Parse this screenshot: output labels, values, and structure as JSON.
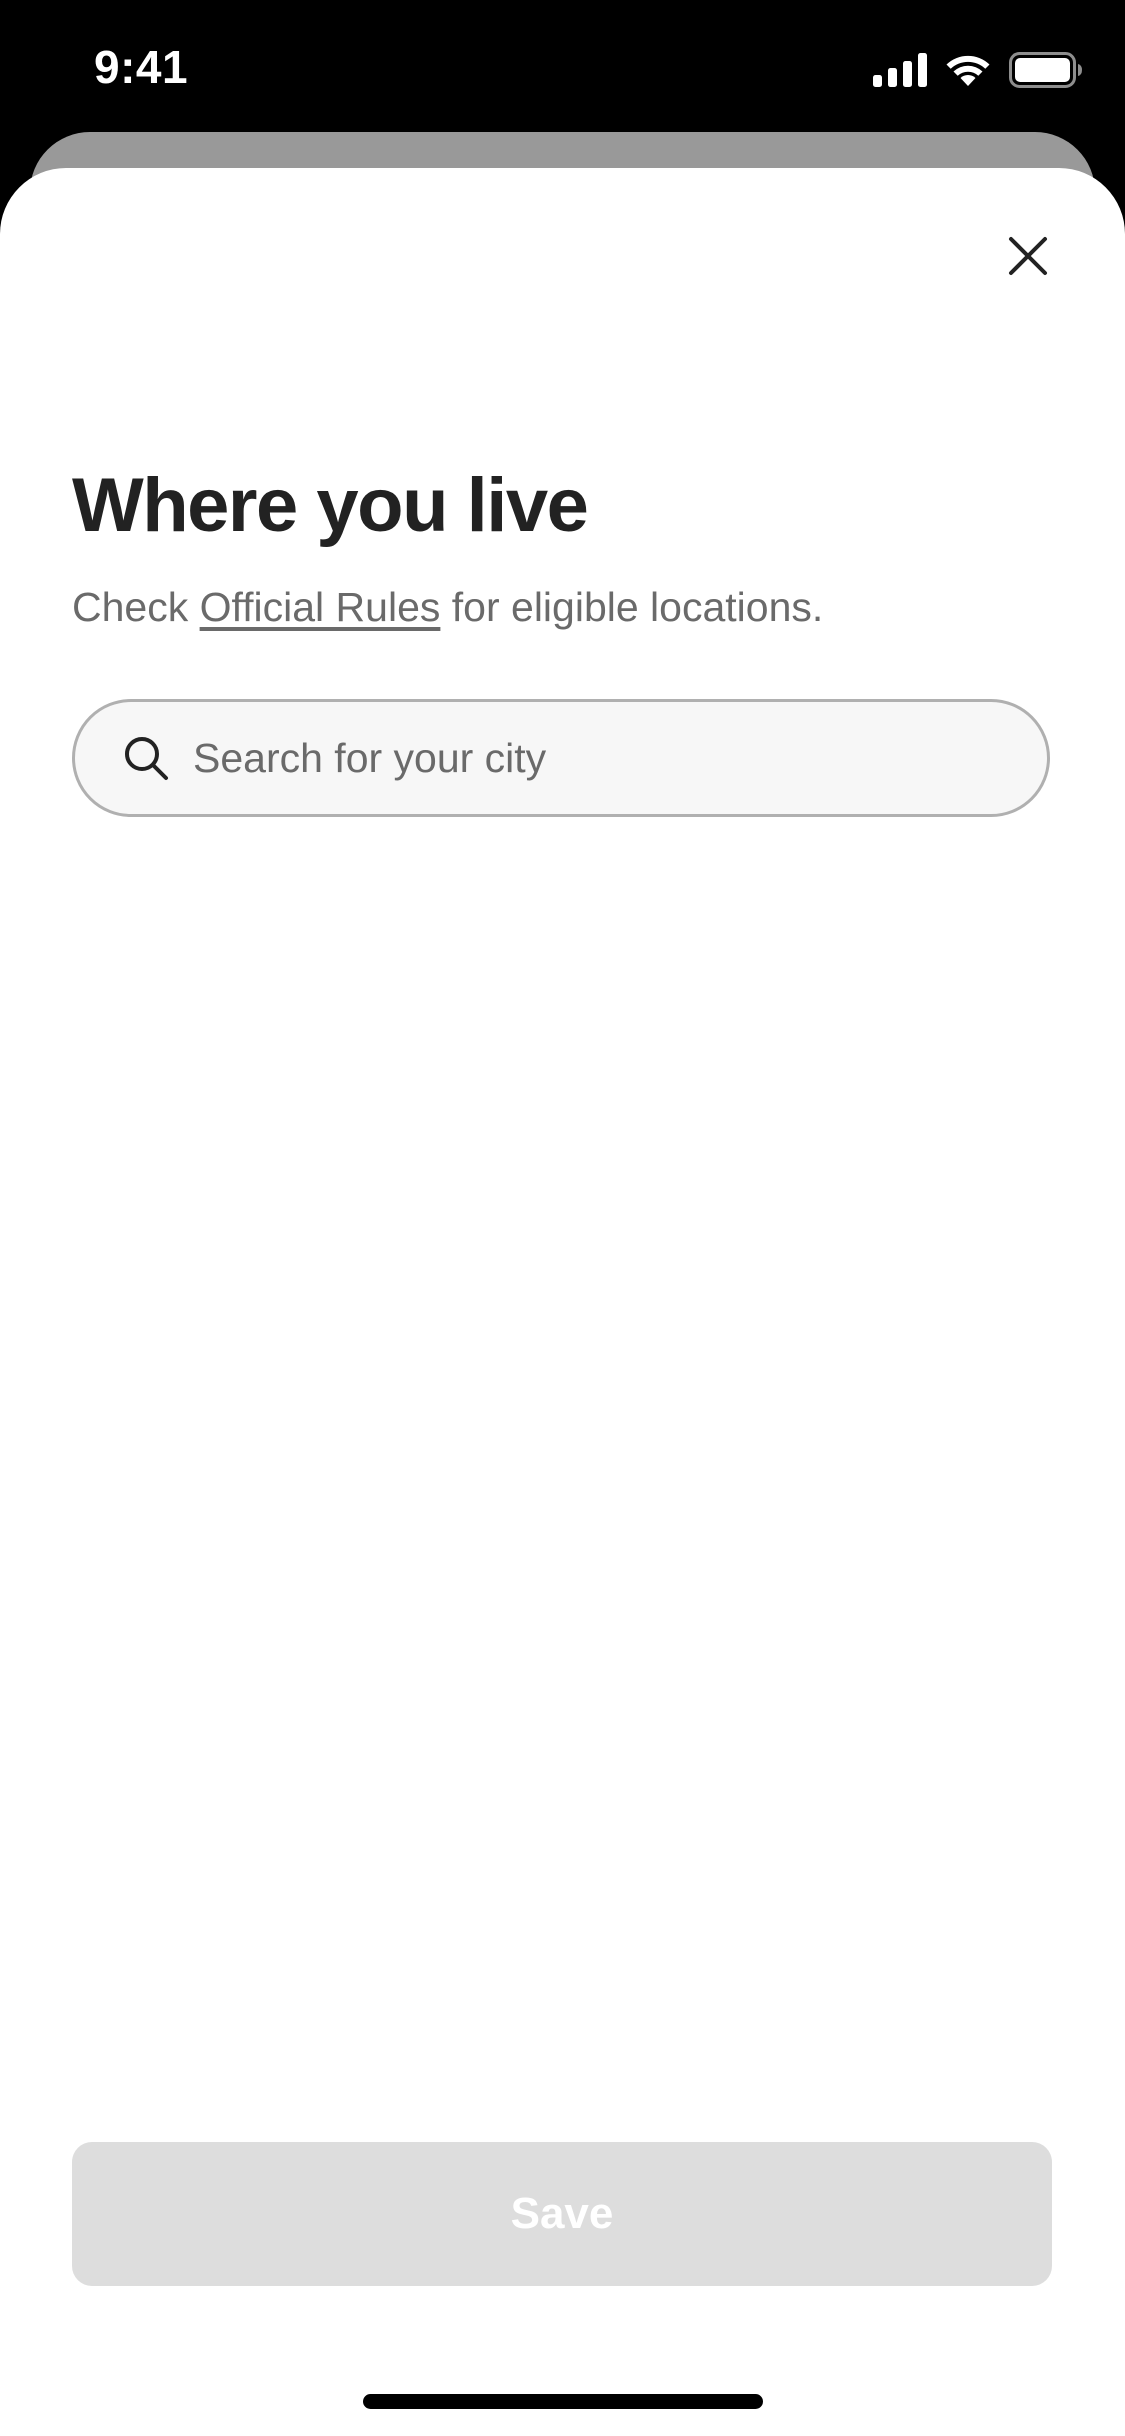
{
  "status_bar": {
    "time": "9:41",
    "icons": [
      "cellular-signal-icon",
      "wifi-icon",
      "battery-icon"
    ]
  },
  "modal": {
    "close_icon": "close-icon",
    "title": "Where you live",
    "subtitle_prefix": "Check ",
    "subtitle_link": "Official Rules",
    "subtitle_suffix": " for eligible locations.",
    "search": {
      "icon": "search-icon",
      "placeholder": "Search for your city",
      "value": ""
    },
    "save_label": "Save"
  },
  "colors": {
    "title_text": "#222222",
    "secondary_text": "#6a6a6a",
    "search_background": "#f7f7f7",
    "search_border": "#b0b0b0",
    "save_button_disabled": "#dddddd",
    "status_bar_background": "#000000"
  }
}
